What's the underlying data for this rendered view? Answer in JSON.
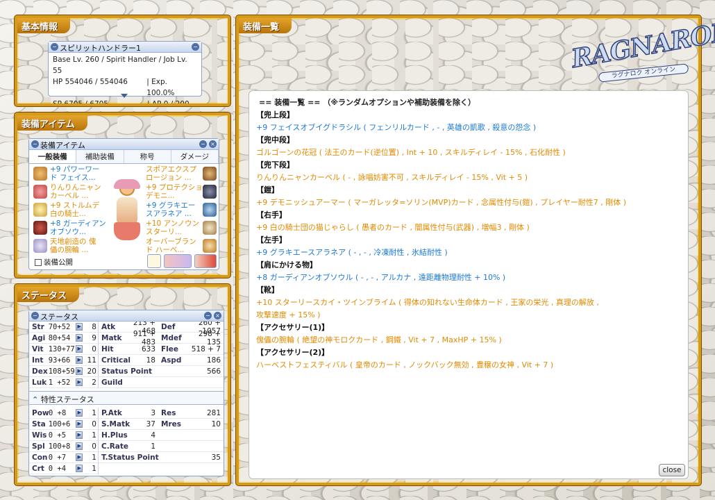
{
  "panels": {
    "basic": "基本情報",
    "equip_items": "装備アイテム",
    "status": "ステータス",
    "equip_list": "装備一覧"
  },
  "logo": {
    "text": "RAGNAROK",
    "sub": "ラグナロク オンライン"
  },
  "basic_window": {
    "title": "スピリットハンドラー1",
    "line1": "Base Lv. 260 / Spirit Handler / Job Lv. 55",
    "hp": "HP 554046 / 554046",
    "exp": "| Exp. 100.0%",
    "sp": "SP 6705 / 6705",
    "ap": "| AP 0 / 200"
  },
  "equip_window": {
    "title": "装備アイテム",
    "tabs": [
      "一般装備",
      "補助装備",
      "称号",
      "ダメージ"
    ],
    "left": [
      {
        "l1": "+9 パワーワー",
        "l2": "ド フェイス...",
        "color": "blue"
      },
      {
        "l1": "りんりんニャン",
        "l2": "カーベル ...",
        "color": "org"
      },
      {
        "l1": "+9 ストルムデ",
        "l2": "白の騎士...",
        "color": "org"
      },
      {
        "l1": "+8 ガーディアン",
        "l2": "オブソウ...",
        "color": "blue"
      },
      {
        "l1": "天地創造の 傀",
        "l2": "儡の腕輪 ...",
        "color": "org"
      }
    ],
    "right": [
      {
        "l1": "スポアエクスプ",
        "l2": "ロージョン ...",
        "color": "org"
      },
      {
        "l1": "+9 プロテクション",
        "l2": "デモニ...",
        "color": "org"
      },
      {
        "l1": "+9 グラキエー",
        "l2": "スアラネア ...",
        "color": "blue"
      },
      {
        "l1": "+10 アンノウン",
        "l2": "スターリ...",
        "color": "org"
      },
      {
        "l1": "オーバーブラン",
        "l2": "ド ハーベ...",
        "color": "org"
      }
    ],
    "public_label": "装備公開"
  },
  "status_window": {
    "title": "ステータス",
    "stats": [
      {
        "k": "Str",
        "v": "70+52",
        "b": "8"
      },
      {
        "k": "Agi",
        "v": "80+54",
        "b": "9"
      },
      {
        "k": "Vit",
        "v": "130+77",
        "b": "0"
      },
      {
        "k": "Int",
        "v": "93+66",
        "b": "11"
      },
      {
        "k": "Dex",
        "v": "108+59",
        "b": "20"
      },
      {
        "k": "Luk",
        "v": "1 +52",
        "b": "2"
      }
    ],
    "sub1": [
      {
        "k": "Atk",
        "v": "213 + 468",
        "k2": "Def",
        "v2": "260 + 1057"
      },
      {
        "k": "Matk",
        "v": "911 + 483",
        "k2": "Mdef",
        "v2": "298 + 135"
      },
      {
        "k": "Hit",
        "v": "633",
        "k2": "Flee",
        "v2": "518 + 7"
      },
      {
        "k": "Critical",
        "v": "18",
        "k2": "Aspd",
        "v2": "186"
      },
      {
        "k": "Status Point",
        "v": "566",
        "k2": "",
        "v2": ""
      },
      {
        "k": "Guild",
        "v": "",
        "k2": "",
        "v2": ""
      }
    ],
    "trait_title": "特性ステータス",
    "traits": [
      {
        "k": "Pow",
        "v": "0 +8",
        "b": "1"
      },
      {
        "k": "Sta",
        "v": "100+6",
        "b": "0"
      },
      {
        "k": "Wis",
        "v": "0 +5",
        "b": "1"
      },
      {
        "k": "Spl",
        "v": "100+8",
        "b": "0"
      },
      {
        "k": "Con",
        "v": "0 +7",
        "b": "1"
      },
      {
        "k": "Crt",
        "v": "0 +4",
        "b": "1"
      }
    ],
    "sub2": [
      {
        "k": "P.Atk",
        "v": "3",
        "k2": "Res",
        "v2": "281"
      },
      {
        "k": "S.Matk",
        "v": "37",
        "k2": "Mres",
        "v2": "10"
      },
      {
        "k": "H.Plus",
        "v": "4",
        "k2": "",
        "v2": ""
      },
      {
        "k": "C.Rate",
        "v": "1",
        "k2": "",
        "v2": ""
      },
      {
        "k": "T.Status Point",
        "v": "35",
        "k2": "",
        "v2": ""
      }
    ]
  },
  "equip_list": {
    "header": "== 装備一覧 == （※ランダムオプションや補助装備を除く）",
    "sections": [
      {
        "title": "【兜上段】",
        "lines": [
          {
            "t": "+9 フェイスオブイグドラシル ( フェンリルカード , - , 英雄の凱歌 , 殺意の怨念 )",
            "c": "blue"
          }
        ]
      },
      {
        "title": "【兜中段】",
        "lines": [
          {
            "t": "ゴルゴーンの花冠 ( 法王のカード(逆位置) , Int + 10 , スキルディレイ - 15% , 石化耐性 )",
            "c": "org"
          }
        ]
      },
      {
        "title": "【兜下段】",
        "lines": [
          {
            "t": "りんりんニャンカーベル ( - , 詠唱妨害不可 , スキルディレイ - 15% , Vit + 5 )",
            "c": "org"
          }
        ]
      },
      {
        "title": "【鎧】",
        "lines": [
          {
            "t": "+9 デモニッシュアーマー ( マーガレッタ=ソリン(MVP)カード , 念属性付与(鎧) , プレイヤー耐性7 , 剛体 )",
            "c": "org"
          }
        ]
      },
      {
        "title": "【右手】",
        "lines": [
          {
            "t": "+9 白の騎士団の猫じゃらし ( 愚者のカード , 闇属性付与(武器) , 増幅3 , 剛体 )",
            "c": "org"
          }
        ]
      },
      {
        "title": "【左手】",
        "lines": [
          {
            "t": "+9 グラキエースアラネア ( - , - , 冷凍耐性 , 氷結耐性 )",
            "c": "blue"
          }
        ]
      },
      {
        "title": "【肩にかける物】",
        "lines": [
          {
            "t": "+8 ガーディアンオブソウル ( - , - , アルカナ , 遠距離物理耐性 + 10% )",
            "c": "blue"
          }
        ]
      },
      {
        "title": "【靴】",
        "lines": [
          {
            "t": "+10 スターリースカイ・ツインブライム ( 得体の知れない生命体カード , 王家の栄光 , 真理の解放 ,",
            "c": "org"
          },
          {
            "t": "攻撃速度 + 15% )",
            "c": "org"
          }
        ]
      },
      {
        "title": "【アクセサリー(1)】",
        "lines": [
          {
            "t": "傀儡の腕輪 ( 絶望の神モロクカード , 鋼鐵 , Vit + 7 , MaxHP + 15% )",
            "c": "org"
          }
        ]
      },
      {
        "title": "【アクセサリー(2)】",
        "lines": [
          {
            "t": "ハーベストフェスティバル ( 皇帝のカード , ノックバック無効 , 豊穣の女神 , Vit + 7 )",
            "c": "org"
          }
        ]
      }
    ]
  },
  "close_label": "close"
}
